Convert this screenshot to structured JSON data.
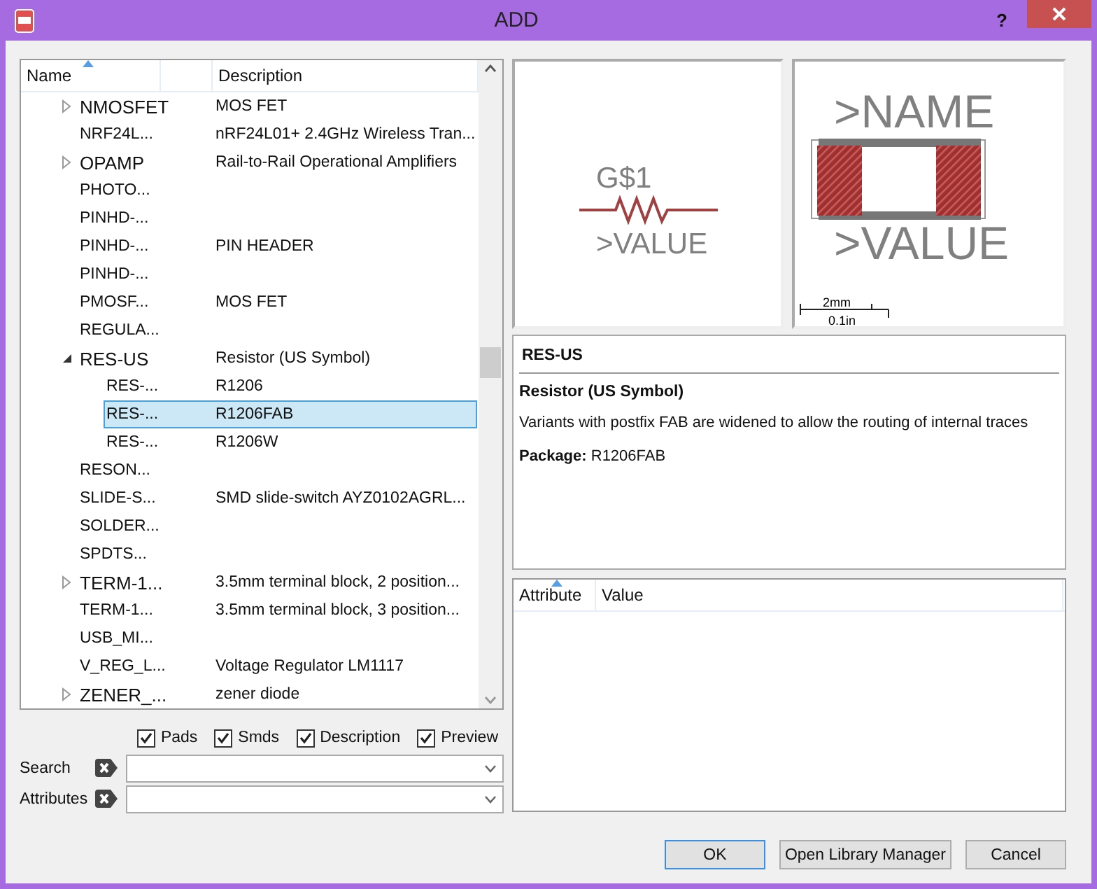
{
  "window": {
    "title": "ADD",
    "help": "?"
  },
  "tree": {
    "columns": [
      "Name",
      "Description"
    ],
    "items": [
      {
        "kind": "folder",
        "name": "NMOSFET",
        "description": "MOS FET",
        "expanded": false,
        "selected": false
      },
      {
        "kind": "leaf",
        "name": "NRF24L...",
        "description": "nRF24L01+ 2.4GHz Wireless Tran...",
        "selected": false
      },
      {
        "kind": "folder",
        "name": "OPAMP",
        "description": "Rail-to-Rail Operational Amplifiers",
        "expanded": false,
        "selected": false
      },
      {
        "kind": "leaf",
        "name": "PHOTO...",
        "selected": false
      },
      {
        "kind": "leaf",
        "name": "PINHD-...",
        "selected": false
      },
      {
        "kind": "leaf",
        "name": "PINHD-...",
        "description": "PIN HEADER",
        "selected": false
      },
      {
        "kind": "leaf",
        "name": "PINHD-...",
        "selected": false
      },
      {
        "kind": "leaf",
        "name": "PMOSF...",
        "description": "MOS FET",
        "selected": false
      },
      {
        "kind": "leaf",
        "name": "REGULA...",
        "selected": false
      },
      {
        "kind": "folder",
        "name": "RES-US",
        "description": "Resistor (US Symbol)",
        "expanded": true,
        "selected": false,
        "children": [
          {
            "kind": "leaf",
            "name": "RES-...",
            "description": "R1206",
            "selected": false
          },
          {
            "kind": "leaf",
            "name": "RES-...",
            "description": "R1206FAB",
            "selected": true
          },
          {
            "kind": "leaf",
            "name": "RES-...",
            "description": "R1206W",
            "selected": false
          }
        ]
      },
      {
        "kind": "leaf",
        "name": "RESON...",
        "selected": false
      },
      {
        "kind": "leaf",
        "name": "SLIDE-S...",
        "description": "SMD slide-switch AYZ0102AGRL...",
        "selected": false
      },
      {
        "kind": "leaf",
        "name": "SOLDER...",
        "selected": false
      },
      {
        "kind": "leaf",
        "name": "SPDTS...",
        "selected": false
      },
      {
        "kind": "folder",
        "name": "TERM-1...",
        "description": "3.5mm terminal block, 2 position...",
        "expanded": false,
        "selected": false
      },
      {
        "kind": "leaf",
        "name": "TERM-1...",
        "description": "3.5mm terminal block, 3 position...",
        "selected": false
      },
      {
        "kind": "leaf",
        "name": "USB_MI...",
        "selected": false
      },
      {
        "kind": "leaf",
        "name": "V_REG_L...",
        "description": "Voltage Regulator LM1117",
        "selected": false
      },
      {
        "kind": "folder",
        "name": "ZENER_...",
        "description": "zener diode",
        "expanded": false,
        "selected": false
      }
    ]
  },
  "filters": [
    {
      "label": "Pads",
      "checked": true
    },
    {
      "label": "Smds",
      "checked": true
    },
    {
      "label": "Description",
      "checked": true
    },
    {
      "label": "Preview",
      "checked": true
    }
  ],
  "fields": [
    {
      "label": "Search"
    },
    {
      "label": "Attributes"
    }
  ],
  "symbol_preview": {
    "name": "G$1",
    "value": ">VALUE"
  },
  "package_preview": {
    "name": ">NAME",
    "value": ">VALUE",
    "scale_metric": "2mm",
    "scale_imperial": "0.1in"
  },
  "info": {
    "title": "RES-US",
    "heading": "Resistor (US Symbol)",
    "text": "Variants with postfix FAB are widened to allow the routing of internal traces",
    "package_label": "Package:",
    "package": "R1206FAB"
  },
  "attributes": {
    "columns": [
      "Attribute",
      "Value"
    ]
  },
  "buttons": [
    {
      "label": "OK",
      "default": true
    },
    {
      "label": "Open Library Manager",
      "default": false
    },
    {
      "label": "Cancel",
      "default": false
    }
  ]
}
